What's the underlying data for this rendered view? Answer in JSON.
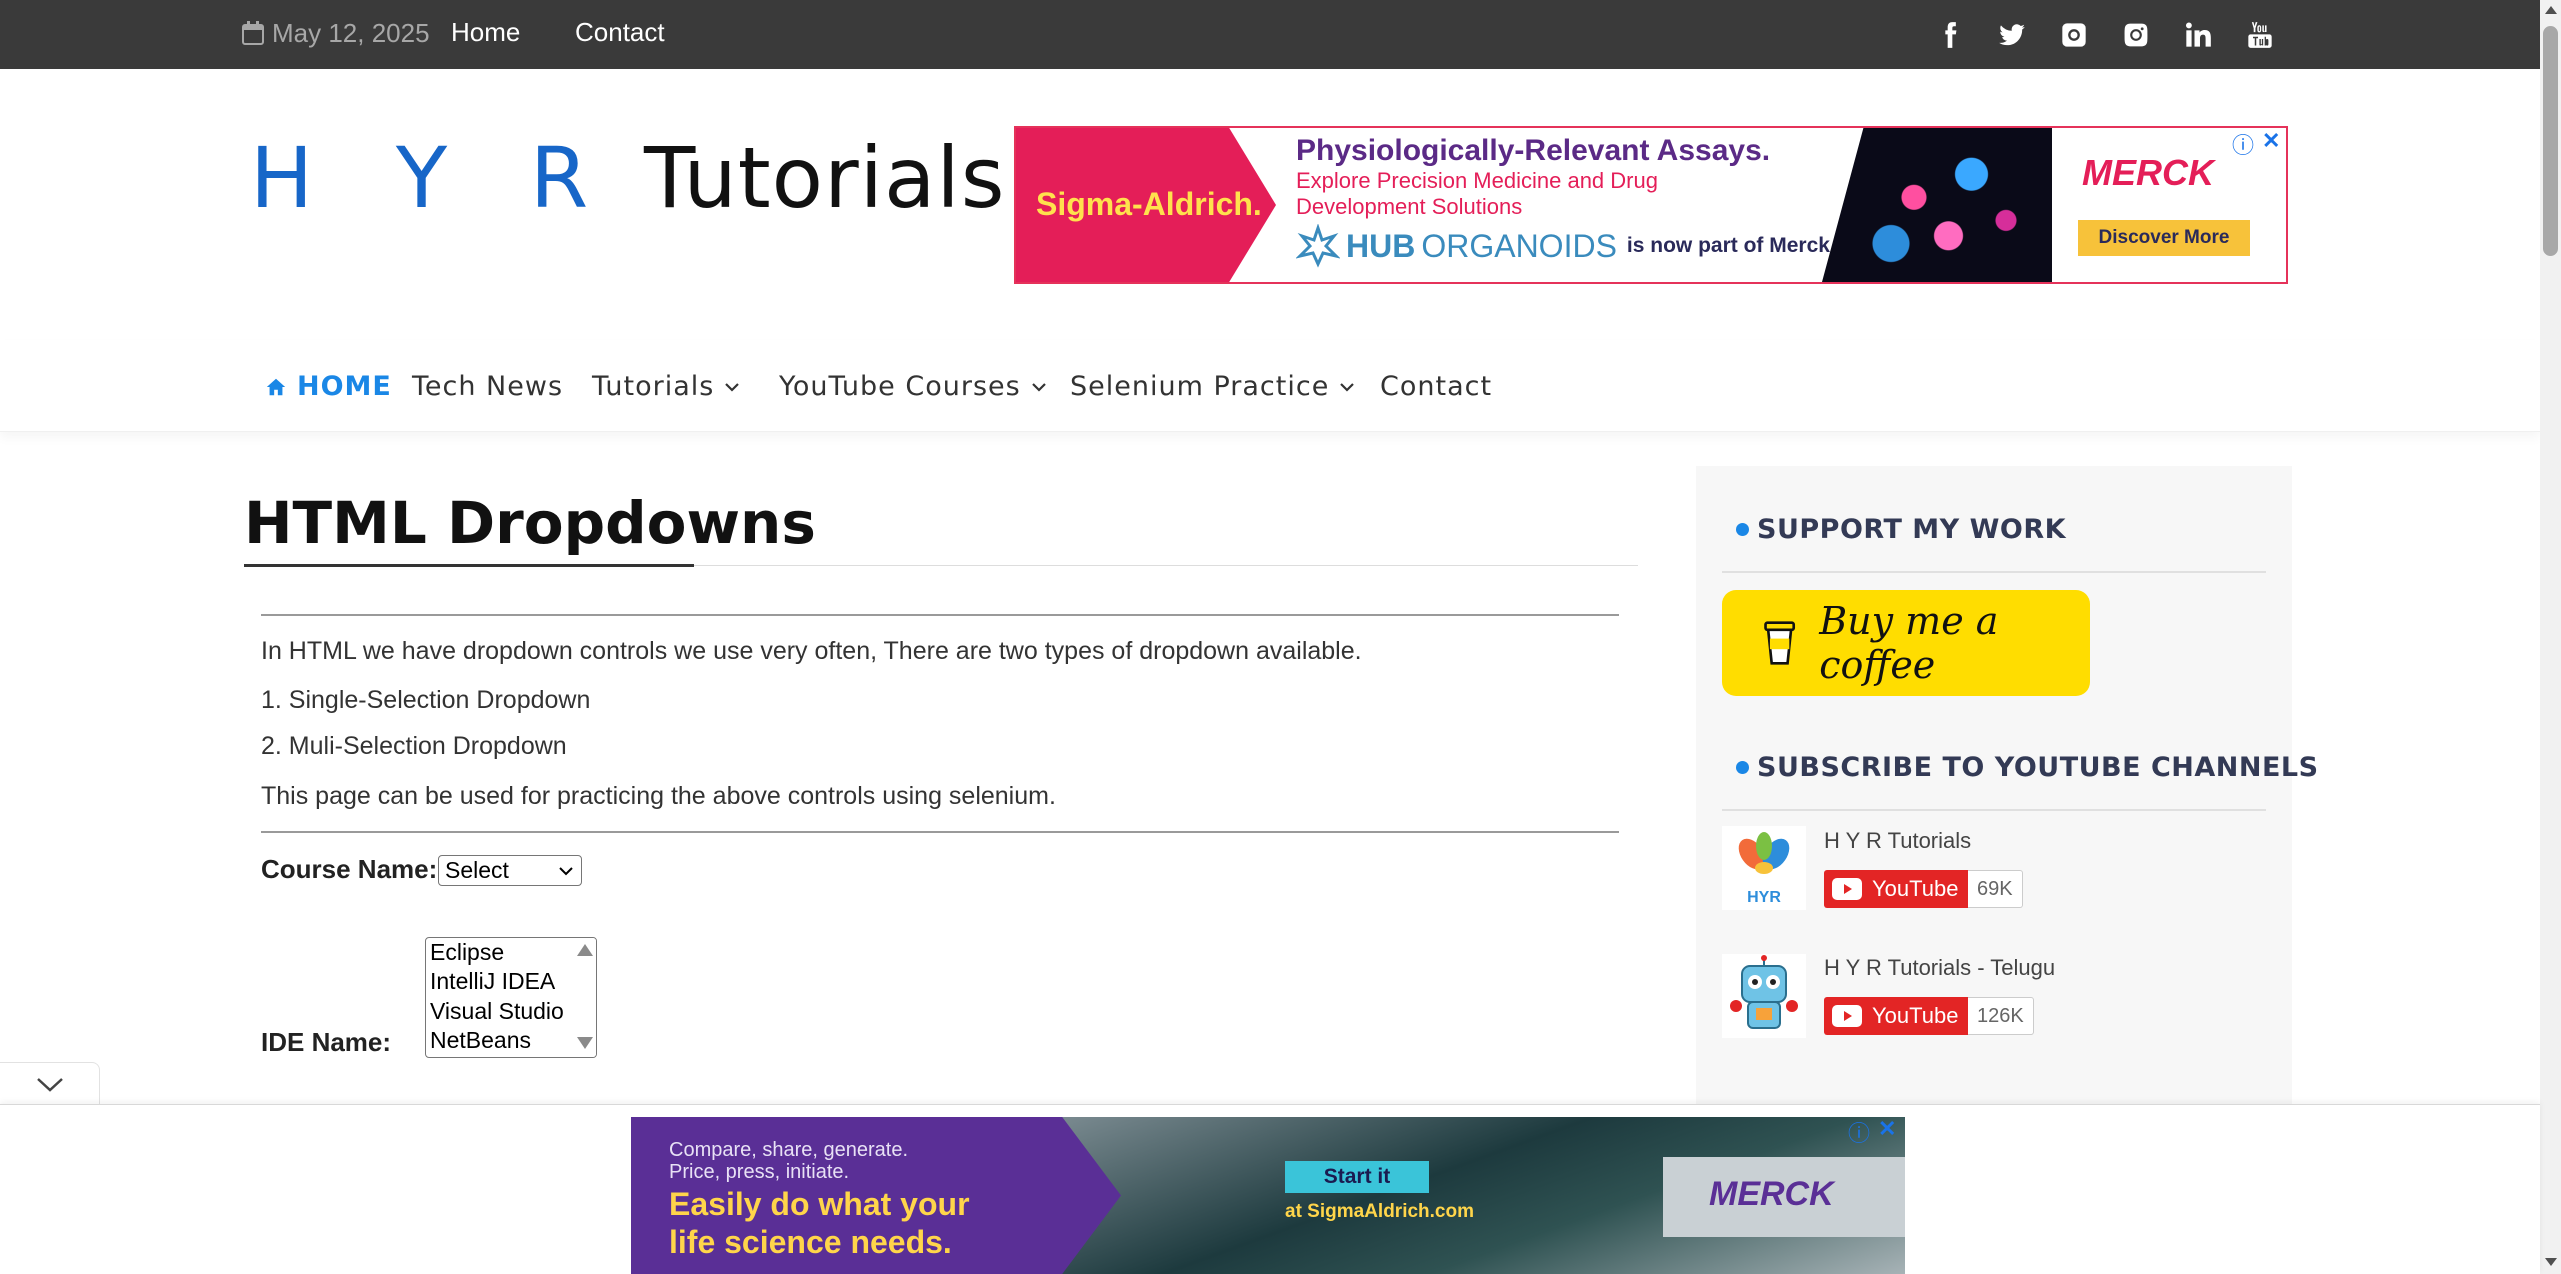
{
  "topbar": {
    "date": "May 12, 2025",
    "links": [
      "Home",
      "Contact"
    ],
    "social_icons": [
      "facebook-icon",
      "twitter-icon",
      "github-icon",
      "instagram-icon",
      "linkedin-icon",
      "youtube-icon"
    ]
  },
  "header": {
    "logo_part1": "H Y R",
    "logo_part2": " Tutorials"
  },
  "ad_top": {
    "brand": "Sigma-Aldrich.",
    "headline": "Physiologically-Relevant Assays.",
    "subline": "Explore Precision Medicine and Drug Development Solutions",
    "hub": "HUB",
    "organoids": "ORGANOIDS",
    "part_of": "is now part of Merck",
    "merck": "MERCK",
    "cta": "Discover More"
  },
  "nav": {
    "home": "HOME",
    "items": [
      "Tech News",
      "Tutorials",
      "YouTube Courses",
      "Selenium Practice",
      "Contact"
    ]
  },
  "main": {
    "title": "HTML Dropdowns",
    "intro": "In HTML we have dropdown controls we use very often, There are two types of dropdown available.",
    "item1": "1. Single-Selection Dropdown",
    "item2": "2. Muli-Selection Dropdown",
    "usage": "This page can be used for practicing the above controls using selenium.",
    "course_label": "Course Name:",
    "course_selected": "Select",
    "ide_label": "IDE Name:",
    "ide_options": [
      "Eclipse",
      "IntelliJ IDEA",
      "Visual Studio",
      "NetBeans"
    ]
  },
  "sidebar": {
    "support_title": "SUPPORT MY WORK",
    "coffee_label": "Buy me a coffee",
    "subscribe_title": "SUBSCRIBE TO YOUTUBE CHANNELS",
    "channels": [
      {
        "name": "H Y R Tutorials",
        "button": "YouTube",
        "count": "69K"
      },
      {
        "name": "H Y R Tutorials - Telugu",
        "button": "YouTube",
        "count": "126K"
      }
    ]
  },
  "ad_bottom": {
    "line1": "Compare, share, generate.",
    "line2": "Price, press, initiate.",
    "big1": "Easily do what your",
    "big2": "life science needs.",
    "cta": "Start it",
    "site": "at SigmaAldrich.com",
    "merck": "MERCK"
  },
  "colors": {
    "topbar": "#3a3a3a",
    "accent_blue": "#1a87e6",
    "logo_blue": "#1766c8",
    "youtube_red": "#e32525",
    "coffee_yellow": "#ffdd00"
  }
}
